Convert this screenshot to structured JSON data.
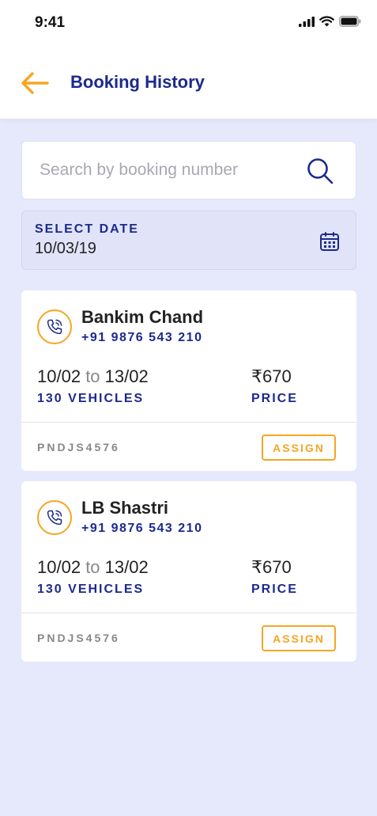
{
  "status_bar": {
    "time": "9:41"
  },
  "header": {
    "title": "Booking History"
  },
  "search": {
    "placeholder": "Search by booking number"
  },
  "date_filter": {
    "label": "SELECT DATE",
    "value": "10/03/19"
  },
  "bookings": [
    {
      "name": "Bankim Chand",
      "phone": "+91 9876 543 210",
      "from": "10/02",
      "to_word": "to",
      "to": "13/02",
      "vehicles": "130 VEHICLES",
      "price": "₹670",
      "price_label": "PRICE",
      "code": "PNDJS4576",
      "action": "ASSIGN"
    },
    {
      "name": "LB Shastri",
      "phone": "+91 9876 543 210",
      "from": "10/02",
      "to_word": "to",
      "to": "13/02",
      "vehicles": "130 VEHICLES",
      "price": "₹670",
      "price_label": "PRICE",
      "code": "PNDJS4576",
      "action": "ASSIGN"
    }
  ],
  "colors": {
    "accent": "#f5a623",
    "brand": "#1b2a8c",
    "background": "#e6e9fb"
  }
}
